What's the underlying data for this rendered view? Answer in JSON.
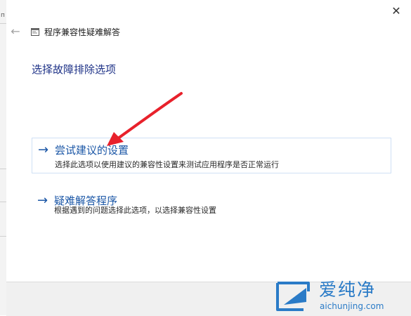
{
  "background_window": {
    "fragment_text": "п"
  },
  "window": {
    "title": "程序兼容性疑难解答",
    "close_glyph": "✕",
    "back_glyph": "←",
    "icon": "troubleshooter-app-icon"
  },
  "page": {
    "heading": "选择故障排除选项",
    "options": [
      {
        "arrow": "→",
        "title": "尝试建议的设置",
        "description": "选择此选项以使用建议的兼容性设置来测试应用程序是否正常运行"
      },
      {
        "arrow": "→",
        "title": "疑难解答程序",
        "description": "根据遇到的问题选择此选项，以选择兼容性设置"
      }
    ]
  },
  "annotation": {
    "type": "red-arrow",
    "color": "#e8212b"
  },
  "watermark": {
    "brand": "爱纯净",
    "url": "aichunjing.com",
    "color": "#2a7bc7"
  },
  "colors": {
    "heading": "#1e3287",
    "link": "#1a56a6",
    "hover_border": "#cfe0f5",
    "footer": "#f0f0f0"
  }
}
